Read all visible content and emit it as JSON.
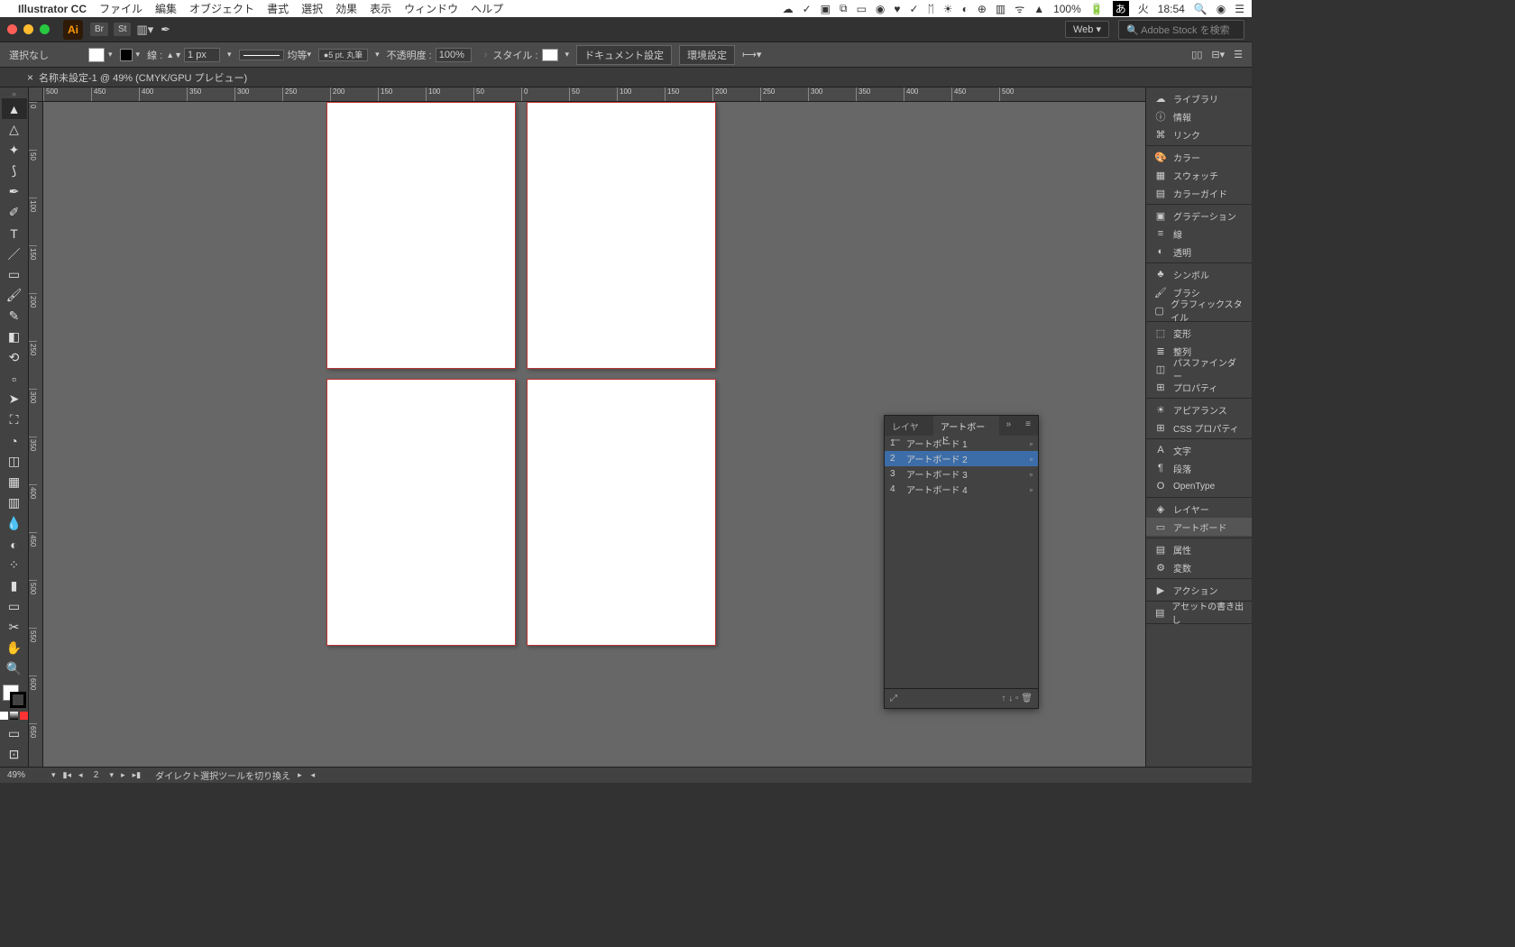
{
  "menubar": {
    "appname": "Illustrator CC",
    "items": [
      "ファイル",
      "編集",
      "オブジェクト",
      "書式",
      "選択",
      "効果",
      "表示",
      "ウィンドウ",
      "ヘルプ"
    ],
    "battery": "100%",
    "day": "火",
    "time": "18:54",
    "ime": "あ"
  },
  "appbar": {
    "workspace": "Web",
    "search_placeholder": "Adobe Stock を検索"
  },
  "controlbar": {
    "selection": "選択なし",
    "stroke_label": "線 :",
    "stroke_width": "1 px",
    "stroke_profile": "均等",
    "brush": "5 pt. 丸筆",
    "opacity_label": "不透明度 :",
    "opacity": "100%",
    "style_label": "スタイル :",
    "doc_setup": "ドキュメント設定",
    "prefs": "環境設定"
  },
  "tab": {
    "title": "名称未設定-1 @ 49% (CMYK/GPU プレビュー)"
  },
  "ruler_h": [
    "500",
    "450",
    "400",
    "350",
    "300",
    "250",
    "200",
    "150",
    "100",
    "50",
    "0",
    "50",
    "100",
    "150",
    "200",
    "250",
    "300",
    "350",
    "400",
    "450",
    "500"
  ],
  "ruler_v": [
    "0",
    "50",
    "100",
    "150",
    "200",
    "250",
    "300",
    "350",
    "400",
    "450",
    "500",
    "550",
    "600",
    "650"
  ],
  "artboards_panel": {
    "tab_layers": "レイヤー",
    "tab_artboards": "アートボード",
    "rows": [
      {
        "num": "1",
        "name": "アートボード 1"
      },
      {
        "num": "2",
        "name": "アートボード 2"
      },
      {
        "num": "3",
        "name": "アートボード 3"
      },
      {
        "num": "4",
        "name": "アートボード 4"
      }
    ],
    "selected": 1
  },
  "right_panels": {
    "groups": [
      [
        {
          "icon": "☁",
          "label": "ライブラリ"
        },
        {
          "icon": "ⓘ",
          "label": "情報"
        },
        {
          "icon": "⌘",
          "label": "リンク"
        }
      ],
      [
        {
          "icon": "🎨",
          "label": "カラー"
        },
        {
          "icon": "▦",
          "label": "スウォッチ"
        },
        {
          "icon": "▤",
          "label": "カラーガイド"
        }
      ],
      [
        {
          "icon": "▣",
          "label": "グラデーション"
        },
        {
          "icon": "≡",
          "label": "線"
        },
        {
          "icon": "◐",
          "label": "透明"
        }
      ],
      [
        {
          "icon": "♣",
          "label": "シンボル"
        },
        {
          "icon": "🖌",
          "label": "ブラシ"
        },
        {
          "icon": "▢",
          "label": "グラフィックスタイル"
        }
      ],
      [
        {
          "icon": "⬚",
          "label": "変形"
        },
        {
          "icon": "≣",
          "label": "整列"
        },
        {
          "icon": "◫",
          "label": "パスファインダー"
        },
        {
          "icon": "⊞",
          "label": "プロパティ"
        }
      ],
      [
        {
          "icon": "☀",
          "label": "アピアランス"
        },
        {
          "icon": "⊞",
          "label": "CSS プロパティ"
        }
      ],
      [
        {
          "icon": "A",
          "label": "文字"
        },
        {
          "icon": "¶",
          "label": "段落"
        },
        {
          "icon": "O",
          "label": "OpenType"
        }
      ],
      [
        {
          "icon": "◈",
          "label": "レイヤー"
        },
        {
          "icon": "▭",
          "label": "アートボード",
          "active": true
        }
      ],
      [
        {
          "icon": "▤",
          "label": "属性"
        },
        {
          "icon": "⚙",
          "label": "変数"
        }
      ],
      [
        {
          "icon": "▶",
          "label": "アクション"
        }
      ],
      [
        {
          "icon": "▤",
          "label": "アセットの書き出し"
        }
      ]
    ]
  },
  "statusbar": {
    "zoom": "49%",
    "artboard_current": "2",
    "hint": "ダイレクト選択ツールを切り換え"
  }
}
